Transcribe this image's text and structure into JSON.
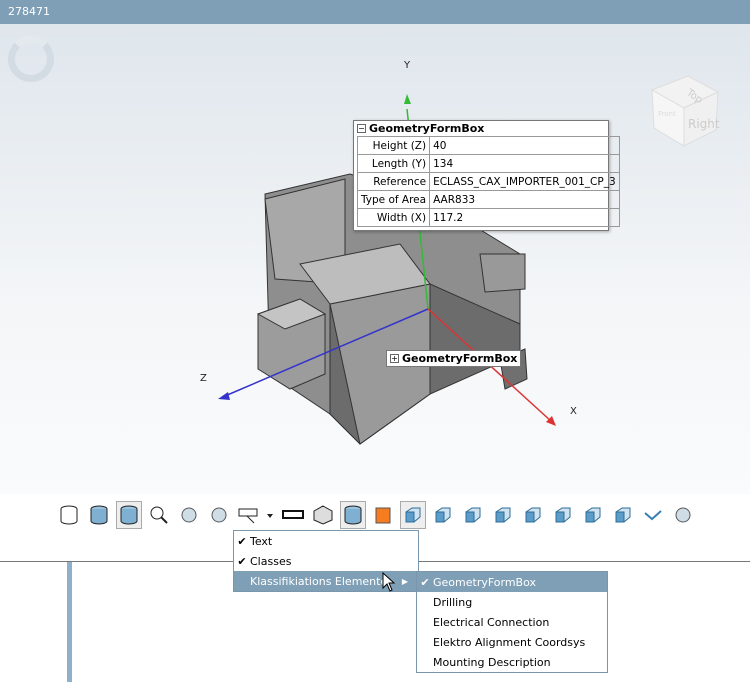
{
  "window": {
    "title": "278471"
  },
  "viewport": {
    "axes": {
      "y": "Y",
      "x": "X",
      "z": "Z"
    },
    "navcube": {
      "top": "Top",
      "right": "Right",
      "front": "Front"
    },
    "info_box": {
      "title": "GeometryFormBox",
      "rows": [
        {
          "key": "Height (Z)",
          "value": "40"
        },
        {
          "key": "Length (Y)",
          "value": "134"
        },
        {
          "key": "Reference",
          "value": "ECLASS_CAX_IMPORTER_001_CP_3"
        },
        {
          "key": "Type of Area",
          "value": "AAR833"
        },
        {
          "key": "Width (X)",
          "value": "117.2"
        }
      ]
    },
    "collapsed_box": {
      "title": "GeometryFormBox"
    }
  },
  "toolbar": {
    "icons": [
      "wireframe-cylinder-icon",
      "shaded-cylinder-icon",
      "shaded-edges-cylinder-icon",
      "zoom-fit-icon",
      "transparency-icon",
      "rotate-animation-icon",
      "annotation-dropdown-icon",
      "measure-ruler-icon",
      "mesh-cube-icon",
      "dimension-cylinder-icon",
      "section-cut-icon",
      "view-iso-icon",
      "view-front-icon",
      "view-back-icon",
      "view-left-icon",
      "view-right-icon",
      "view-top-icon",
      "view-bottom-icon",
      "view-iso2-icon",
      "path-icon",
      "clip-plane-icon"
    ]
  },
  "menu": {
    "items": [
      {
        "label": "Text",
        "checked": true
      },
      {
        "label": "Classes",
        "checked": true
      },
      {
        "label": "Klassifikiations Elemente",
        "checked": false
      }
    ],
    "submenu": [
      {
        "label": "GeometryFormBox",
        "checked": true
      },
      {
        "label": "Drilling",
        "checked": false
      },
      {
        "label": "Electrical Connection",
        "checked": false
      },
      {
        "label": "Elektro Alignment Coordsys",
        "checked": false
      },
      {
        "label": "Mounting Description",
        "checked": false
      }
    ]
  }
}
